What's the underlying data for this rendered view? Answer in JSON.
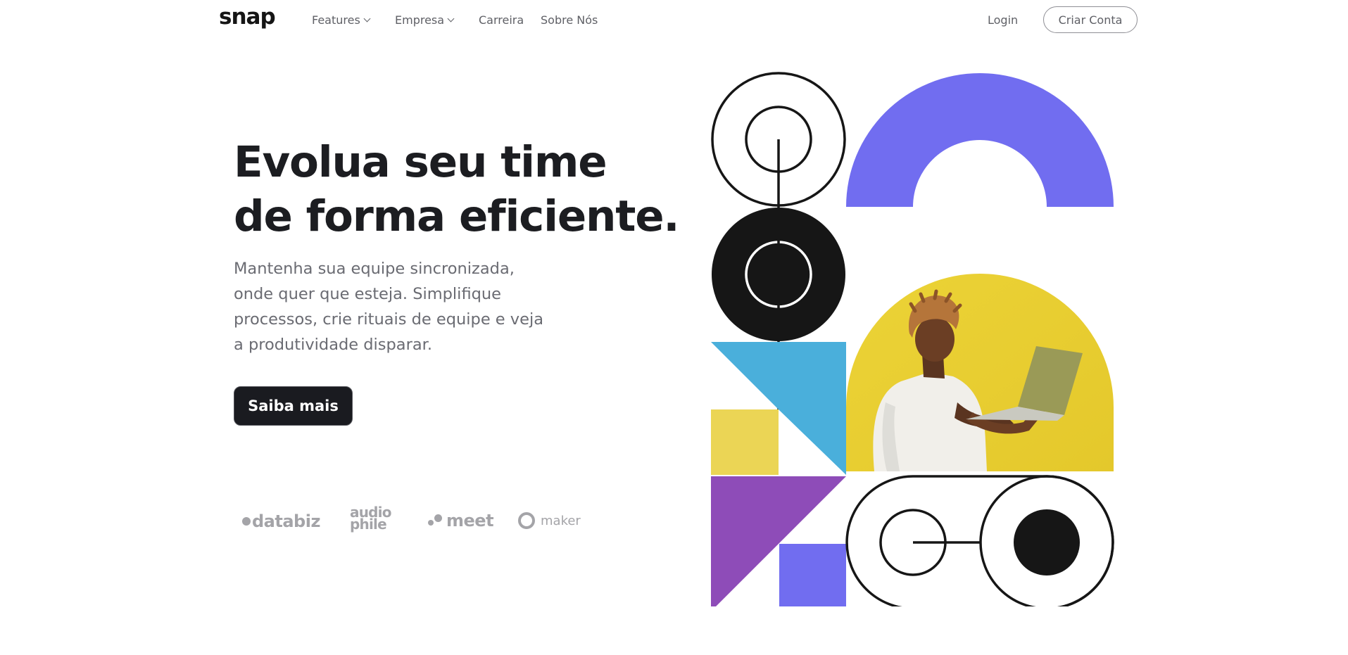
{
  "brand": {
    "logo": "snap"
  },
  "nav": {
    "items": [
      {
        "label": "Features",
        "has_dropdown": true
      },
      {
        "label": "Empresa",
        "has_dropdown": true
      },
      {
        "label": "Carreira",
        "has_dropdown": false
      },
      {
        "label": "Sobre Nós",
        "has_dropdown": false
      }
    ],
    "login": "Login",
    "signup": "Criar Conta"
  },
  "hero": {
    "title_lines": [
      "Evolua seu time",
      "de forma eficiente."
    ],
    "description_lines": [
      "Mantenha sua equipe sincronizada,",
      "onde quer que esteja. Simplifique",
      "processos, crie rituais de equipe e veja",
      "a produtividade disparar."
    ],
    "cta": "Saiba mais"
  },
  "clients": {
    "databiz": "databiz",
    "audiophile_top": "audio",
    "audiophile_bottom": "phile",
    "meet": "meet",
    "maker": "maker"
  },
  "colors": {
    "purple": "#716df0",
    "yellow": "#e9d03d",
    "blue": "#4aafdb",
    "violet": "#8e4cb8",
    "black": "#161616",
    "text_dark": "#1c1d21",
    "text_muted": "#6a6b72"
  }
}
